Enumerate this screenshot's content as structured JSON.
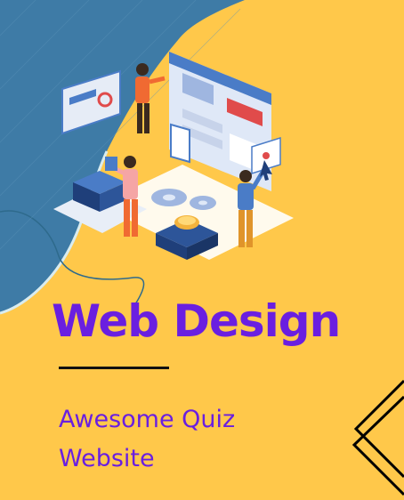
{
  "poster": {
    "title": "Web Design",
    "subtitle_line1": "Awesome Quiz",
    "subtitle_line2": "Website"
  },
  "colors": {
    "background": "#ffc84a",
    "blob": "#3e7ba6",
    "title": "#6a1fe0",
    "subtitle": "#6a1fe0",
    "underline": "#111111"
  },
  "illustration": {
    "icons": [
      "browser-window-icon",
      "gear-icon",
      "coin-icon",
      "server-stack-icon",
      "cursor-icon"
    ]
  }
}
